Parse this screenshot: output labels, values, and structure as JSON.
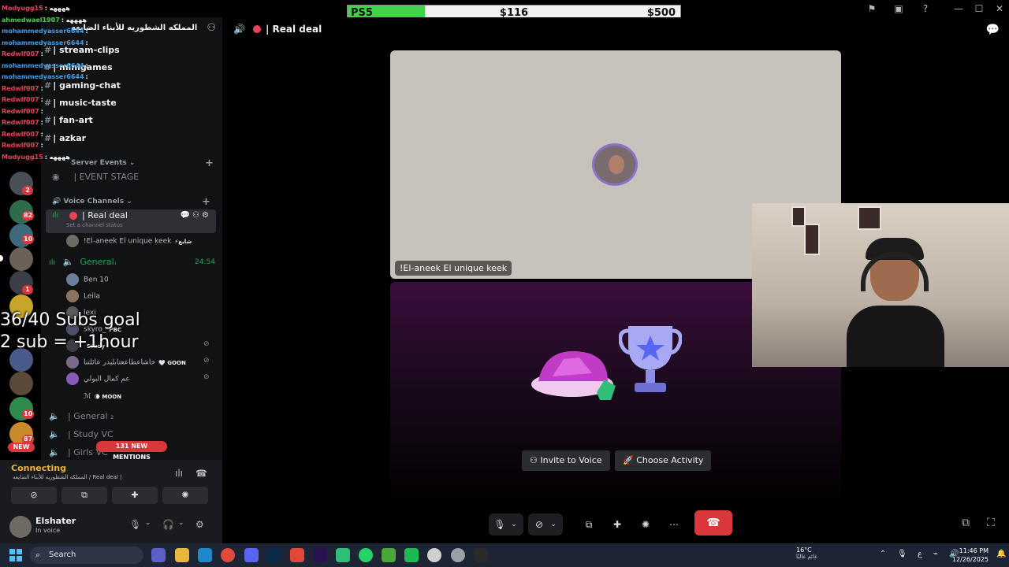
{
  "goal": {
    "label": "PS5",
    "current": "$116",
    "max": "$500",
    "progress": 0.232
  },
  "server": {
    "name": "المملكه الشطوريه للأبناء الضايعه"
  },
  "text_channels": [
    {
      "name": "| stream-clips"
    },
    {
      "name": "| minigames"
    },
    {
      "name": "| gaming-chat"
    },
    {
      "name": "| music-taste"
    },
    {
      "name": "| fan-art"
    },
    {
      "name": "| azkar"
    }
  ],
  "categories": {
    "server_events": "Server Events",
    "voice_channels": "Voice Channels"
  },
  "event_stage": "| EVENT STAGE",
  "active_channel": {
    "name": "| Real deal",
    "status": "Set a channel status"
  },
  "real_deal_members": [
    {
      "name": "!El-aneek El unique keek",
      "tag": "⚡شايع"
    }
  ],
  "general": {
    "name": "General",
    "suffix": "₁",
    "time": "24:54"
  },
  "general_members": [
    {
      "name": "Ben 10",
      "tag": ""
    },
    {
      "name": "Leila",
      "tag": ""
    },
    {
      "name": "lexi",
      "tag": ""
    },
    {
      "name": "skyro_",
      "tag": "PBC"
    },
    {
      "name": "",
      "tag": "Study"
    },
    {
      "name": "خاشاعطاععتابليدر عائلتنا",
      "tag": "🤍 GOON"
    },
    {
      "name": "عم كمال البولي",
      "tag": ""
    },
    {
      "name": "ℳ",
      "tag": "🌘 MOON"
    }
  ],
  "other_voice": [
    {
      "name": "| General ₂"
    },
    {
      "name": "| Study VC"
    },
    {
      "name": "| Girls VC"
    }
  ],
  "mentions_badge": "131 NEW MENTIONS",
  "rail_badges": [
    "2",
    "82",
    "10",
    "1",
    "10",
    "87"
  ],
  "rail_new": "NEW",
  "voice_panel": {
    "status": "Connecting",
    "location": "المملكه الشطوريه للأبناء الضايعه / Real deal |"
  },
  "user": {
    "name": "Elshater",
    "status": "In voice"
  },
  "chat_overlay": [
    {
      "user": "Modyugg15",
      "msg": ": ههههه",
      "color": "#e84357"
    },
    {
      "user": "ahmedwael1907",
      "msg": ": ههههه",
      "color": "#3fd34a"
    },
    {
      "user": "mohammedyasser6644",
      "msg": ":",
      "color": "#3f9de8"
    },
    {
      "user": "mohammedyasser6644",
      "msg": ":",
      "color": "#3f9de8"
    },
    {
      "user": "Redwlf007",
      "msg": ":",
      "color": "#e84357"
    },
    {
      "user": "mohammedyasser6644",
      "msg": ":",
      "color": "#3f9de8"
    },
    {
      "user": "mohammedyasser6644",
      "msg": ":",
      "color": "#3f9de8"
    },
    {
      "user": "Redwlf007",
      "msg": ":",
      "color": "#e84357"
    },
    {
      "user": "Redwlf007",
      "msg": ":",
      "color": "#e84357"
    },
    {
      "user": "Redwlf007",
      "msg": ":",
      "color": "#e84357"
    },
    {
      "user": "Redwlf007",
      "msg": ":",
      "color": "#e84357"
    },
    {
      "user": "Redwlf007",
      "msg": ":",
      "color": "#e84357"
    },
    {
      "user": "Redwlf007",
      "msg": ":",
      "color": "#e84357"
    },
    {
      "user": "Modyugg15",
      "msg": ": ههههه",
      "color": "#e84357"
    }
  ],
  "subs_goal": {
    "line1": "36/40 Subs goal",
    "line2": "2 sub = +1hour"
  },
  "stage": {
    "channel_title": "| Real deal",
    "participant": "!El-aneek El unique keek",
    "invite_button": "Invite to Voice",
    "activity_button": "Choose Activity"
  },
  "taskbar": {
    "search_placeholder": "Search",
    "weather_temp": "16°C",
    "weather_desc": "غائم غالبًا",
    "lang": "ع",
    "time": "11:46 PM",
    "date": "12/26/2025"
  },
  "colors": {
    "accent": "#5865f2",
    "danger": "#da373c",
    "connecting": "#f0b232",
    "speaking": "#23a55a"
  }
}
